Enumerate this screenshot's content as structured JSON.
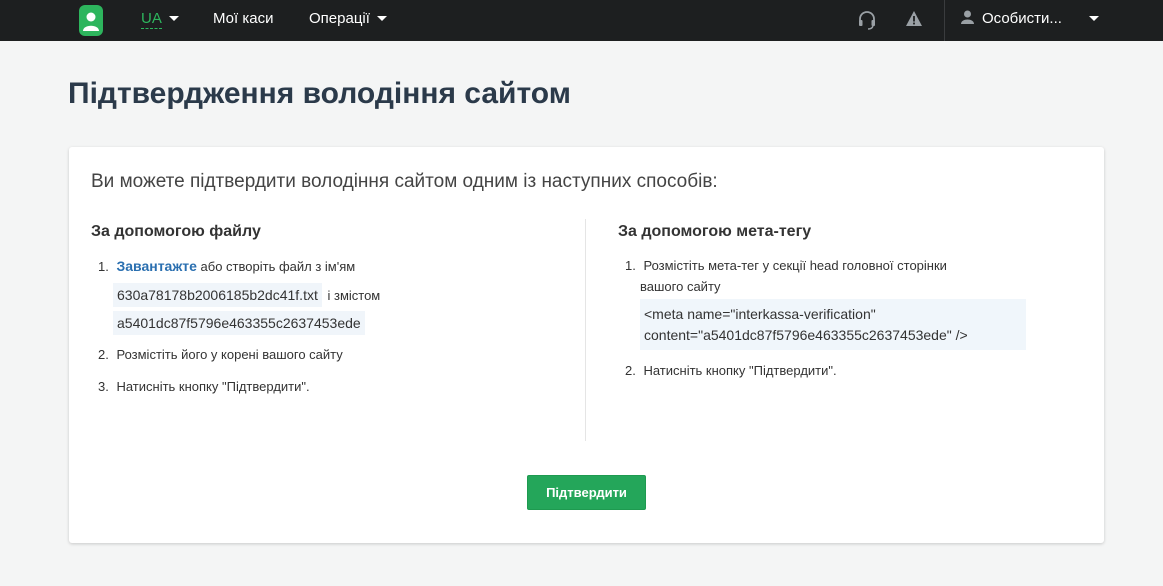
{
  "nav": {
    "lang": "UA",
    "my_kasy": "Мої каси",
    "operations": "Операції",
    "user": "Особисти..."
  },
  "page_title": "Підтвердження володіння сайтом",
  "intro": "Ви можете підтвердити володіння сайтом одним із наступних способів:",
  "file_method": {
    "title": "За допомогою файлу",
    "step1_num": "1.",
    "step1_link": "Завантажте",
    "step1_text": "або створіть файл з ім'ям",
    "file_name": "630a78178b2006185b2dc41f.txt",
    "with_content": "і змістом",
    "content": "a5401dc87f5796e463355c2637453ede",
    "step2_num": "2.",
    "step2_text": "Розмістіть його у корені вашого сайту",
    "step3_num": "3.",
    "step3_text": "Натисніть кнопку \"Підтвердити\"."
  },
  "meta_method": {
    "title": "За допомогою мета-тегу",
    "step1_num": "1.",
    "step1_line1": "Розмістіть мета-тег у секції head головної сторінки",
    "step1_line2": "вашого сайту",
    "meta_line1": "<meta name=\"interkassa-verification\"",
    "meta_line2": "content=\"a5401dc87f5796e463355c2637453ede\" />",
    "step2_num": "2.",
    "step2_text": "Натисніть кнопку \"Підтвердити\"."
  },
  "confirm_label": "Підтвердити",
  "colors": {
    "navbar": "#1d1f20",
    "accent": "#2db55d",
    "button": "#24a65a",
    "link": "#2a6fb0"
  }
}
